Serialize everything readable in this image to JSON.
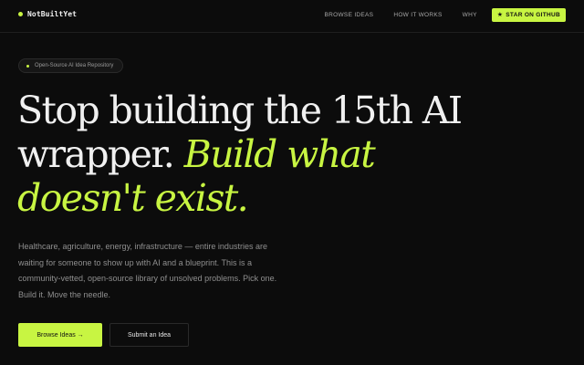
{
  "brand": {
    "name": "NotBuiltYet"
  },
  "nav": {
    "links": [
      "BROWSE IDEAS",
      "HOW IT WORKS",
      "WHY"
    ],
    "star_label": "STAR ON GITHUB",
    "star_icon": "★"
  },
  "badge": {
    "text": "Open-Source AI Idea Repository"
  },
  "hero": {
    "line1": "Stop building the 15th AI",
    "line2_plain": "wrapper.",
    "line2_accent": "Build what",
    "line3_accent": "doesn't exist.",
    "description": "Healthcare, agriculture, energy, infrastructure — entire industries are waiting for someone to show up with AI and a blueprint. This is a community-vetted, open-source library of unsolved problems. Pick one. Build it. Move the needle."
  },
  "cta": {
    "primary_label": "Browse Ideas →",
    "secondary_label": "Submit an Idea"
  },
  "colors": {
    "accent": "#c8f542",
    "background": "#0c0c0c"
  }
}
